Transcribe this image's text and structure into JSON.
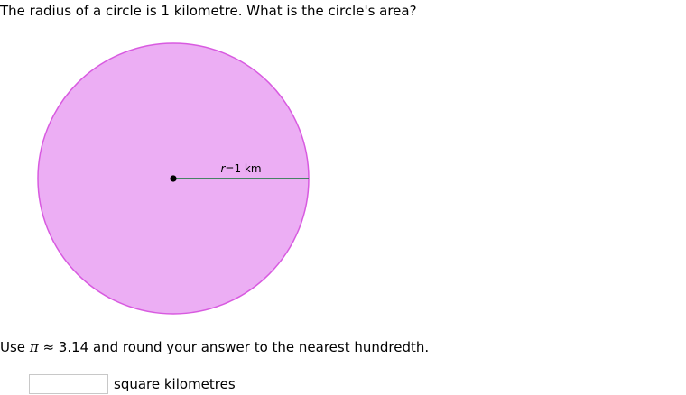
{
  "question": {
    "text": "The radius of a circle is 1 kilometre. What is the circle's area?"
  },
  "figure": {
    "radius_var": "r",
    "radius_rest": "=1 km",
    "colors": {
      "fill": "#ecaef4",
      "stroke": "#d85ae0",
      "radius_line": "#2e7d4f",
      "center_dot": "#000000"
    }
  },
  "instruction": {
    "prefix": "Use",
    "pi_symbol": "π",
    "suffix": " ≈ 3.14 and round your answer to the nearest hundredth."
  },
  "answer": {
    "value": "",
    "placeholder": "",
    "unit": "square kilometres"
  }
}
